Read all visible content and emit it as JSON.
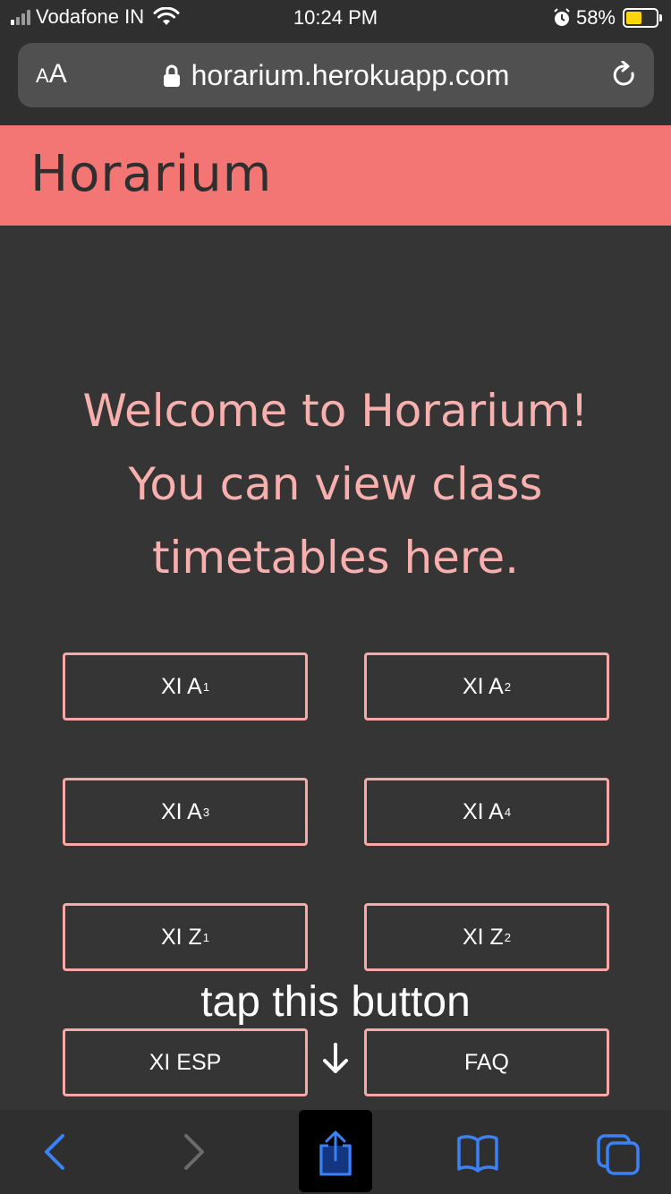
{
  "status_bar": {
    "carrier": "Vodafone IN",
    "time": "10:24 PM",
    "battery_percent": "58%",
    "battery_level": 0.58
  },
  "url_bar": {
    "text_size_small": "A",
    "text_size_big": "A",
    "url": "horarium.herokuapp.com"
  },
  "header": {
    "title": "Horarium"
  },
  "welcome": {
    "line1": "Welcome to Horarium!",
    "line2": "You can view class",
    "line3": "timetables here."
  },
  "classes": [
    {
      "label": "XI A",
      "sub": "1"
    },
    {
      "label": "XI A",
      "sub": "2"
    },
    {
      "label": "XI A",
      "sub": "3"
    },
    {
      "label": "XI A",
      "sub": "4"
    },
    {
      "label": "XI Z",
      "sub": "1"
    },
    {
      "label": "XI Z",
      "sub": "2"
    }
  ],
  "extra_buttons": {
    "esp": "XI ESP",
    "faq": "FAQ"
  },
  "annotation": {
    "text": "tap this button"
  },
  "colors": {
    "background": "#353535",
    "header": "#f47674",
    "accent_text": "#f8b0ae",
    "button_border": "#f8a8a6",
    "ios_blue": "#3b82f6"
  },
  "toolbar_icons": [
    "back-icon",
    "forward-icon",
    "share-icon",
    "bookmarks-icon",
    "tabs-icon"
  ]
}
